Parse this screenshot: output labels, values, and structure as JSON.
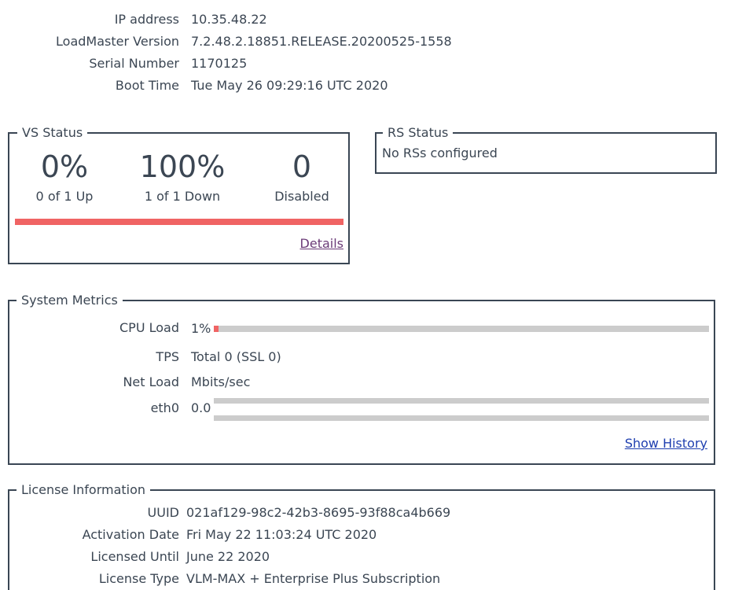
{
  "device_info": [
    {
      "label": "IP address",
      "value": "10.35.48.22"
    },
    {
      "label": "LoadMaster Version",
      "value": "7.2.48.2.18851.RELEASE.20200525-1558"
    },
    {
      "label": "Serial Number",
      "value": "1170125"
    },
    {
      "label": "Boot Time",
      "value": "Tue May 26 09:29:16 UTC 2020"
    }
  ],
  "vs_status": {
    "title": "VS Status",
    "up_percent": "0%",
    "up_caption": "0 of 1 Up",
    "down_percent": "100%",
    "down_caption": "1 of 1 Down",
    "disabled_count": "0",
    "disabled_caption": "Disabled",
    "down_fraction": 1.0,
    "details_link": "Details"
  },
  "rs_status": {
    "title": "RS Status",
    "message": "No RSs configured"
  },
  "system_metrics": {
    "title": "System Metrics",
    "cpu_label": "CPU Load",
    "cpu_value": "1%",
    "cpu_fraction": 0.01,
    "tps_label": "TPS",
    "tps_value": "Total 0 (SSL 0)",
    "net_label": "Net Load",
    "net_unit": "Mbits/sec",
    "eth_label": "eth0",
    "eth_value": "0.0",
    "show_history_link": "Show History"
  },
  "license_info": {
    "title": "License Information",
    "rows": [
      {
        "label": "UUID",
        "value": "021af129-98c2-42b3-8695-93f88ca4b669"
      },
      {
        "label": "Activation Date",
        "value": "Fri May 22 11:03:24 UTC 2020"
      },
      {
        "label": "Licensed Until",
        "value": "June 22 2020"
      },
      {
        "label": "License Type",
        "value": "VLM-MAX + Enterprise Plus Subscription"
      }
    ]
  },
  "colors": {
    "text": "#3b4653",
    "border": "#3a4654",
    "alert_red": "#f06464",
    "bar_track": "#cccccc",
    "visited_link": "#6b3b78",
    "link": "#1f3fb0"
  }
}
